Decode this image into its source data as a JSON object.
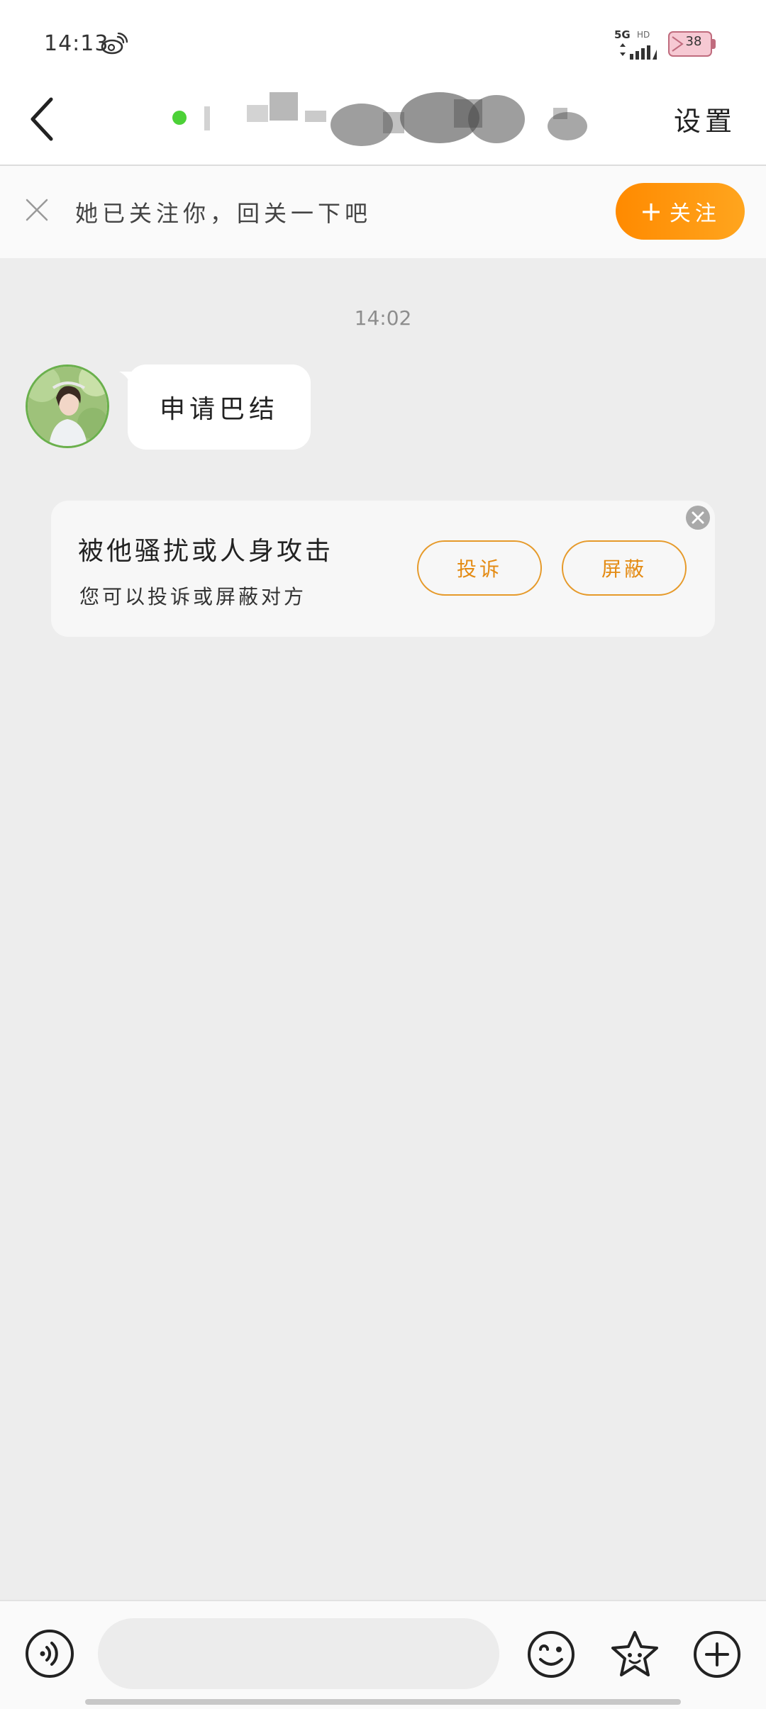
{
  "status_bar": {
    "time": "14:13",
    "network": "5G",
    "hd": "HD",
    "battery": "38",
    "weibo_icon": "weibo-icon",
    "signal_icon": "signal-icon"
  },
  "nav": {
    "back_icon": "chevron-left-icon",
    "settings_label": "设置",
    "online_color": "#4cd137"
  },
  "follow_banner": {
    "text": "她已关注你，回关一下吧",
    "button_label": "关注",
    "button_icon": "plus-icon",
    "accent": "#ff8a00"
  },
  "chat": {
    "timestamp": "14:02",
    "messages": [
      {
        "from": "other",
        "text": "申请巴结"
      }
    ]
  },
  "report_card": {
    "title": "被他骚扰或人身攻击",
    "subtitle": "您可以投诉或屏蔽对方",
    "complain_label": "投诉",
    "block_label": "屏蔽",
    "accent": "#e48b13"
  },
  "input_bar": {
    "voice_icon": "voice-icon",
    "emoji_icon": "emoji-icon",
    "sticker_icon": "sticker-icon",
    "more_icon": "plus-circle-icon",
    "placeholder": ""
  }
}
